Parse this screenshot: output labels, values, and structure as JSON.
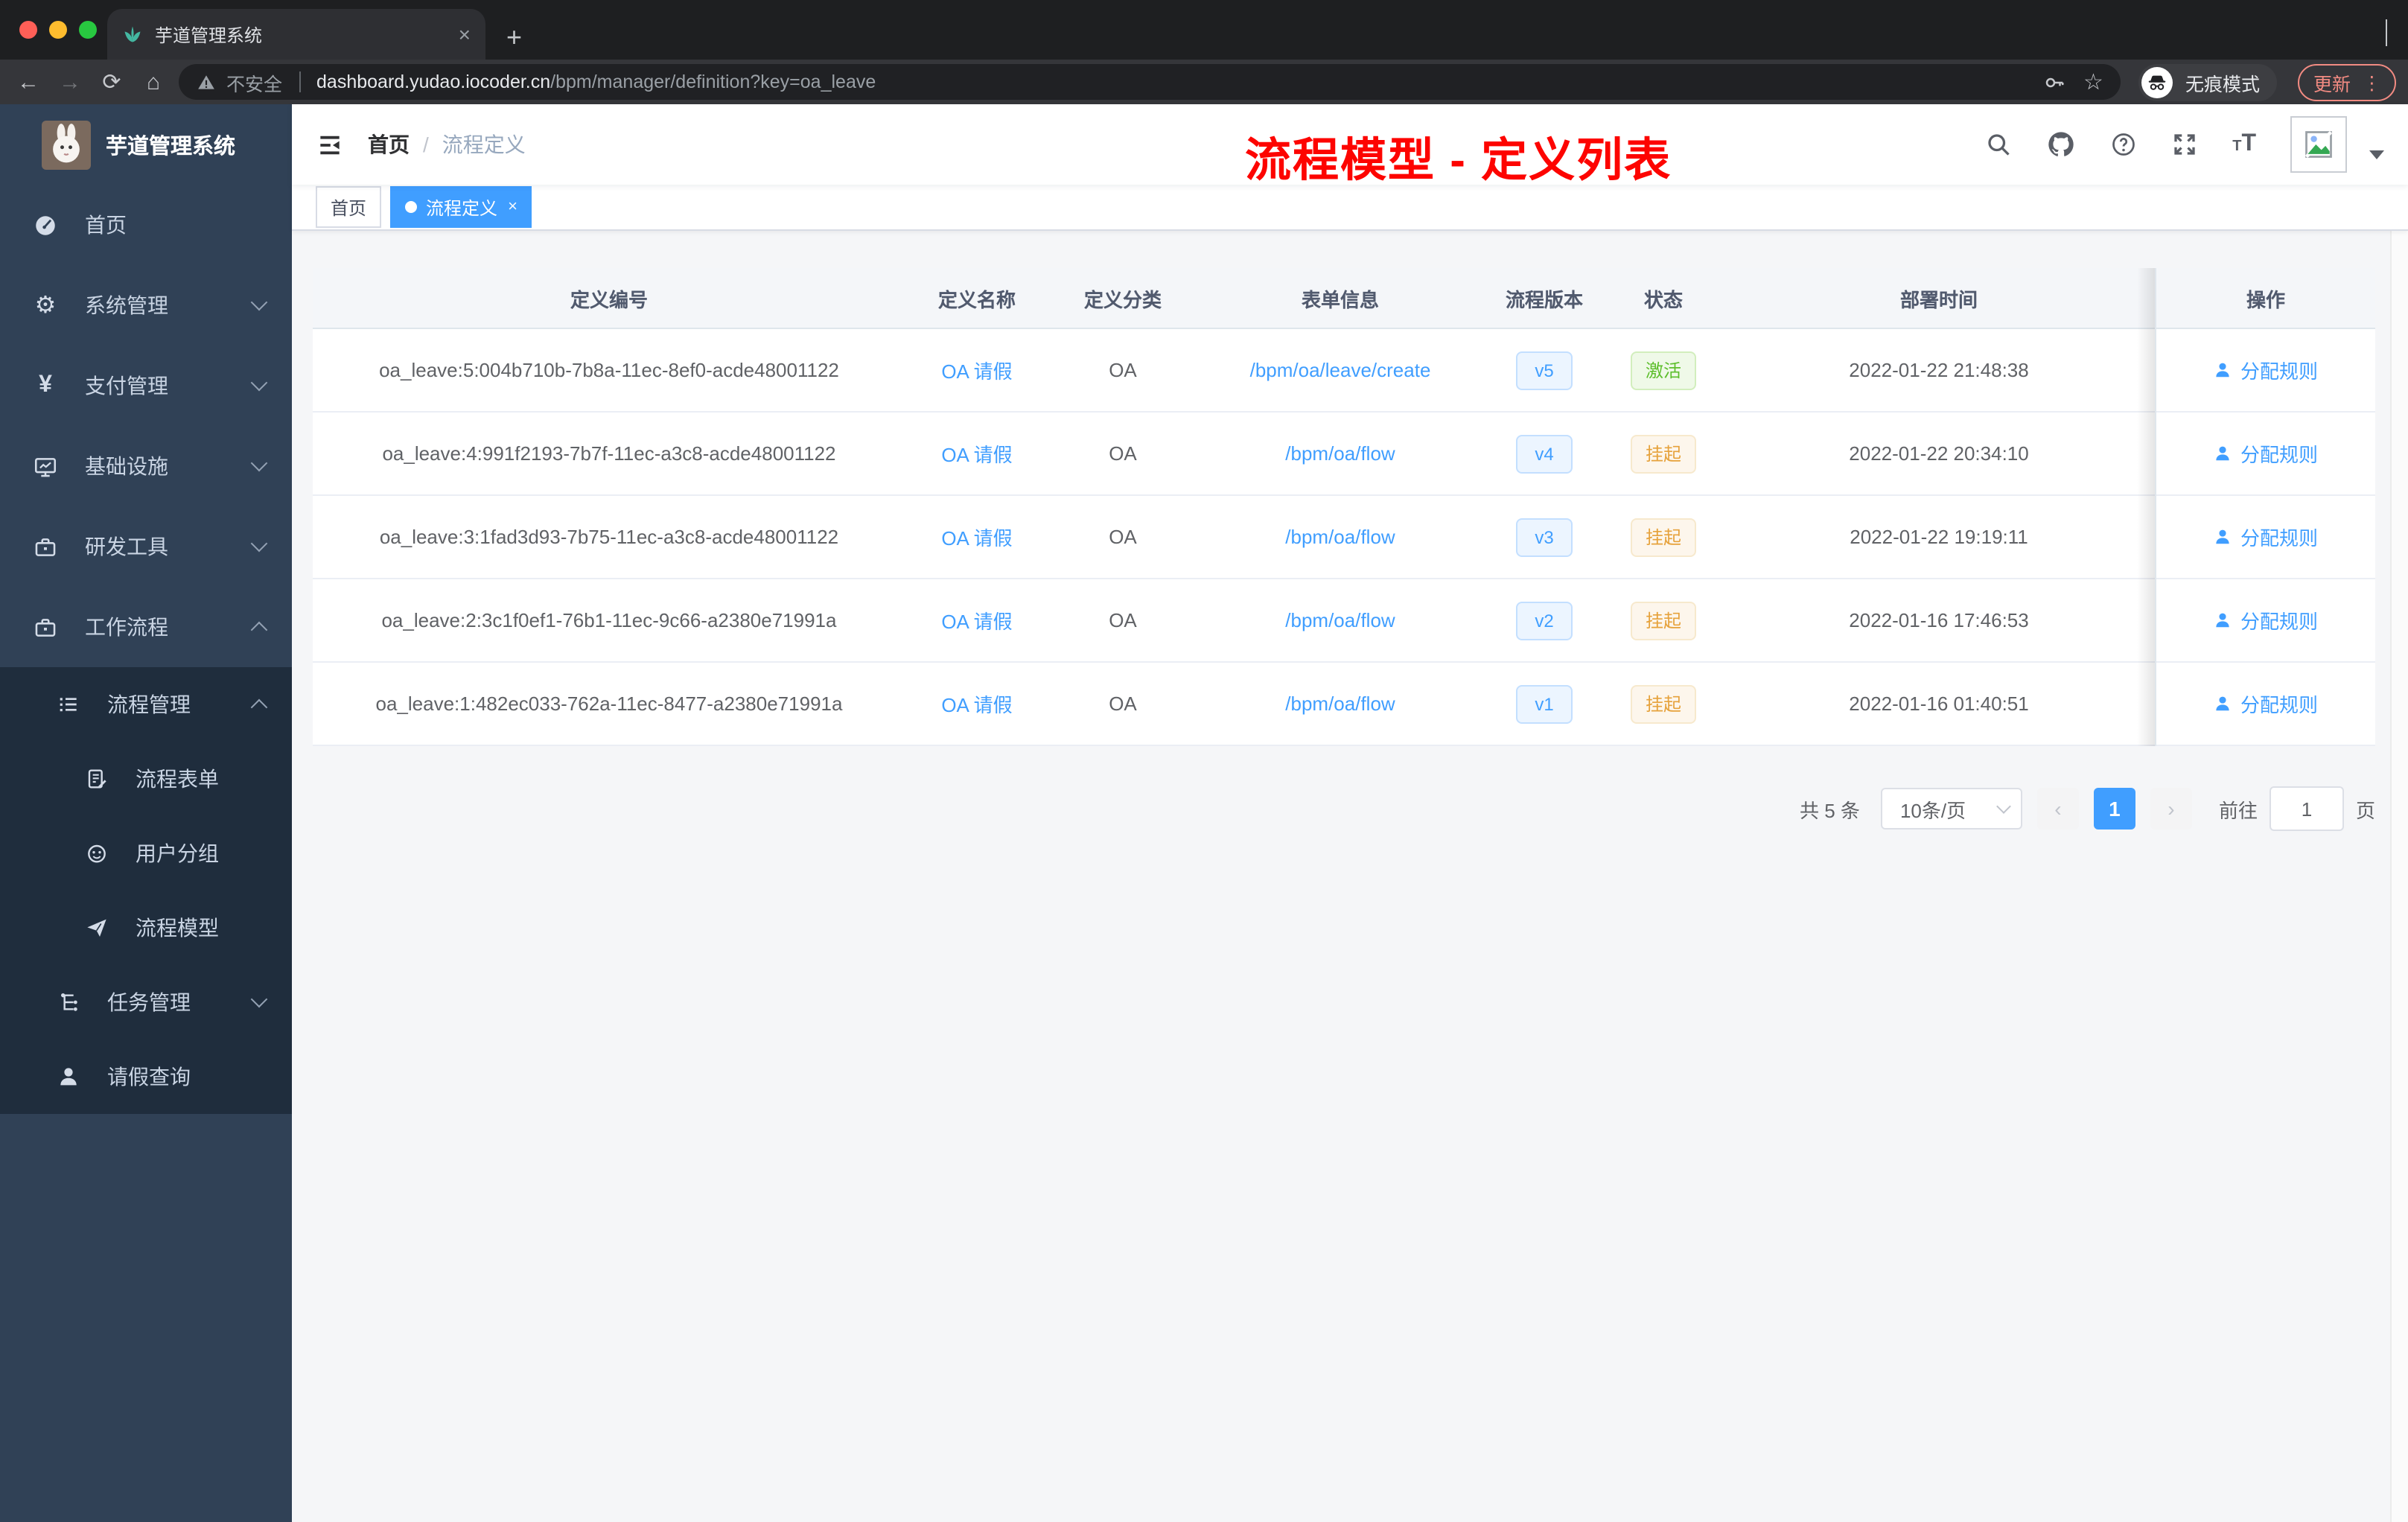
{
  "browser": {
    "tab": {
      "title": "芋道管理系统",
      "close_glyph": "×",
      "new_tab_glyph": "+"
    },
    "toolbar": {
      "back_glyph": "←",
      "forward_glyph": "→",
      "reload_glyph": "⟳",
      "home_glyph": "⌂",
      "security_text": "不安全",
      "url_domain": "dashboard.yudao.iocoder.cn",
      "url_path": "/bpm/manager/definition?key=oa_leave",
      "star_glyph": "☆",
      "incognito_label": "无痕模式",
      "update_label": "更新",
      "menu_dots_glyph": "⋮"
    }
  },
  "sidebar": {
    "logo_title": "芋道管理系统",
    "items": [
      {
        "label": "首页"
      },
      {
        "label": "系统管理"
      },
      {
        "label": "支付管理"
      },
      {
        "label": "基础设施"
      },
      {
        "label": "研发工具"
      },
      {
        "label": "工作流程"
      },
      {
        "label": "流程管理"
      },
      {
        "label": "流程表单"
      },
      {
        "label": "用户分组"
      },
      {
        "label": "流程模型"
      },
      {
        "label": "任务管理"
      },
      {
        "label": "请假查询"
      }
    ]
  },
  "header": {
    "breadcrumb": [
      "首页",
      "流程定义"
    ],
    "breadcrumb_separator": "/",
    "annotation": "流程模型 - 定义列表",
    "size_icon_text": "T"
  },
  "tags": [
    {
      "label": "首页"
    },
    {
      "label": "流程定义",
      "close_glyph": "×"
    }
  ],
  "table": {
    "columns": [
      "定义编号",
      "定义名称",
      "定义分类",
      "表单信息",
      "流程版本",
      "状态",
      "部署时间",
      "操作"
    ],
    "action_label": "分配规则",
    "rows": [
      {
        "id": "oa_leave:5:004b710b-7b8a-11ec-8ef0-acde48001122",
        "name": "OA 请假",
        "category": "OA",
        "form": "/bpm/oa/leave/create",
        "version": "v5",
        "status": "激活",
        "deploy_time": "2022-01-22 21:48:38"
      },
      {
        "id": "oa_leave:4:991f2193-7b7f-11ec-a3c8-acde48001122",
        "name": "OA 请假",
        "category": "OA",
        "form": "/bpm/oa/flow",
        "version": "v4",
        "status": "挂起",
        "deploy_time": "2022-01-22 20:34:10"
      },
      {
        "id": "oa_leave:3:1fad3d93-7b75-11ec-a3c8-acde48001122",
        "name": "OA 请假",
        "category": "OA",
        "form": "/bpm/oa/flow",
        "version": "v3",
        "status": "挂起",
        "deploy_time": "2022-01-22 19:19:11"
      },
      {
        "id": "oa_leave:2:3c1f0ef1-76b1-11ec-9c66-a2380e71991a",
        "name": "OA 请假",
        "category": "OA",
        "form": "/bpm/oa/flow",
        "version": "v2",
        "status": "挂起",
        "deploy_time": "2022-01-16 17:46:53"
      },
      {
        "id": "oa_leave:1:482ec033-762a-11ec-8477-a2380e71991a",
        "name": "OA 请假",
        "category": "OA",
        "form": "/bpm/oa/flow",
        "version": "v1",
        "status": "挂起",
        "deploy_time": "2022-01-16 01:40:51"
      }
    ]
  },
  "pagination": {
    "total": "共 5 条",
    "page_size": "10条/页",
    "prev_glyph": "‹",
    "current_page": "1",
    "next_glyph": "›",
    "goto_label": "前往",
    "goto_value": "1",
    "page_suffix": "页"
  },
  "colors": {
    "accent": "#409eff",
    "success": "#67c23a",
    "warning": "#e6a23c",
    "sidebar_bg": "#304156",
    "submenu_bg": "#1f2d3d",
    "active_tag": "#409eff",
    "annotation_red": "#fd0400",
    "update_button": "#f28b82"
  }
}
